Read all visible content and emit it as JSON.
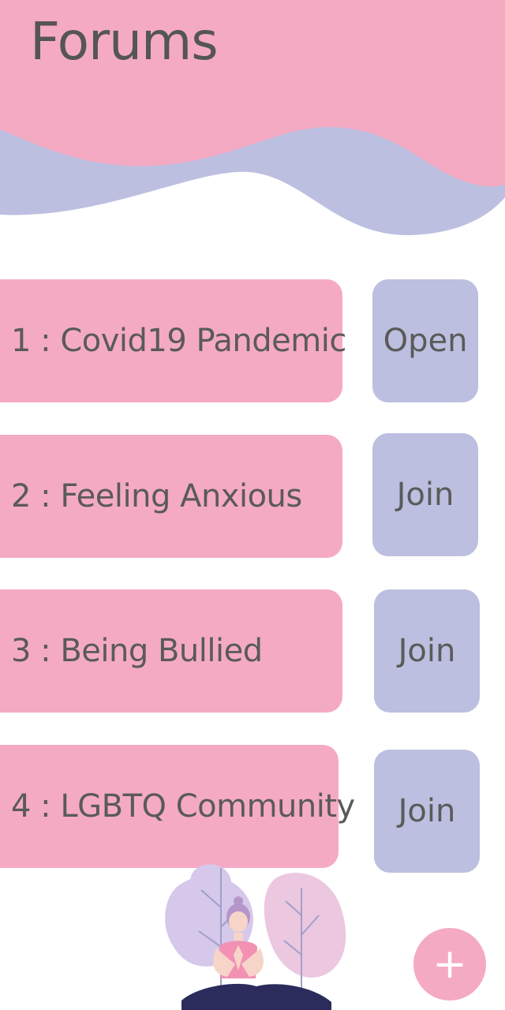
{
  "header": {
    "title": "Forums"
  },
  "forums": [
    {
      "label": "1 : Covid19 Pandemic",
      "action": "Open"
    },
    {
      "label": "2 : Feeling Anxious",
      "action": "Join"
    },
    {
      "label": "3 : Being Bullied",
      "action": "Join"
    },
    {
      "label": "4 : LGBTQ Community",
      "action": "Join"
    }
  ],
  "fab": {
    "icon": "plus-icon",
    "label": "+"
  },
  "colors": {
    "pink": "#f5aac4",
    "lavender": "#bcbfdf",
    "text": "#555555",
    "background": "#ffffff"
  }
}
